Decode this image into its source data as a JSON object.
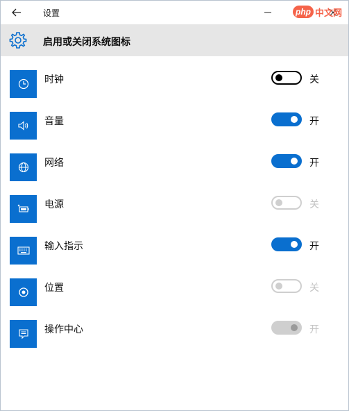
{
  "titlebar": {
    "title": "设置",
    "watermark_logo": "php",
    "watermark_text": "中文网"
  },
  "header": {
    "title": "启用或关闭系统图标",
    "icon": "gear-icon"
  },
  "items": [
    {
      "label": "时钟",
      "icon": "clock-icon",
      "toggle": "off",
      "state_text": "关",
      "enabled": true
    },
    {
      "label": "音量",
      "icon": "volume-icon",
      "toggle": "on",
      "state_text": "开",
      "enabled": true
    },
    {
      "label": "网络",
      "icon": "globe-icon",
      "toggle": "on",
      "state_text": "开",
      "enabled": true
    },
    {
      "label": "电源",
      "icon": "battery-icon",
      "toggle": "off",
      "state_text": "关",
      "enabled": false
    },
    {
      "label": "输入指示",
      "icon": "keyboard-icon",
      "toggle": "on",
      "state_text": "开",
      "enabled": true
    },
    {
      "label": "位置",
      "icon": "location-icon",
      "toggle": "off",
      "state_text": "关",
      "enabled": false
    },
    {
      "label": "操作中心",
      "icon": "action-center-icon",
      "toggle": "on",
      "state_text": "开",
      "enabled": false
    }
  ],
  "colors": {
    "accent": "#0a6fcf",
    "header_bg": "#e6e6e6",
    "disabled": "#cfcfcf",
    "watermark": "#f5634a"
  }
}
